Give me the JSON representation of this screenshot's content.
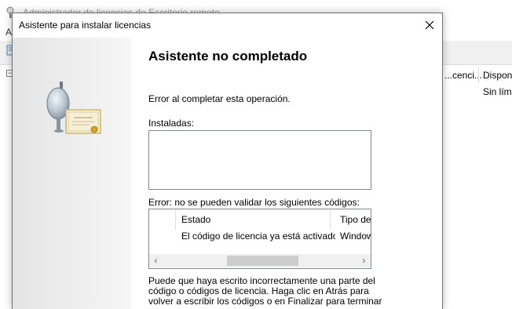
{
  "parent_window": {
    "title": "Administrador de licencias de Escritorio remoto",
    "menu_letter": "A",
    "columns": [
      "...cenci...",
      "Dispon"
    ],
    "row_value": "Sin lím"
  },
  "dialog": {
    "title": "Asistente para instalar licencias",
    "heading": "Asistente no completado",
    "message": "Error al completar esta operación.",
    "installed_label": "Instaladas:",
    "error_label": "Error: no se pueden validar los siguientes códigos:",
    "table": {
      "columns": [
        "Estado",
        "Tipo de p"
      ],
      "rows": [
        {
          "estado": "El código de licencia ya está activado.",
          "tipo": "Windows"
        }
      ]
    },
    "footer_lines": [
      "Puede que haya escrito incorrectamente una parte del",
      "código o códigos de licencia. Haga clic en Atrás para",
      "volver a escribir los códigos o en Finalizar para terminar"
    ]
  },
  "icons": [
    "rd-licensing-app-icon",
    "toolbar-icon",
    "close-icon",
    "license-certificate-icon",
    "scroll-left-icon",
    "scroll-right-icon"
  ]
}
